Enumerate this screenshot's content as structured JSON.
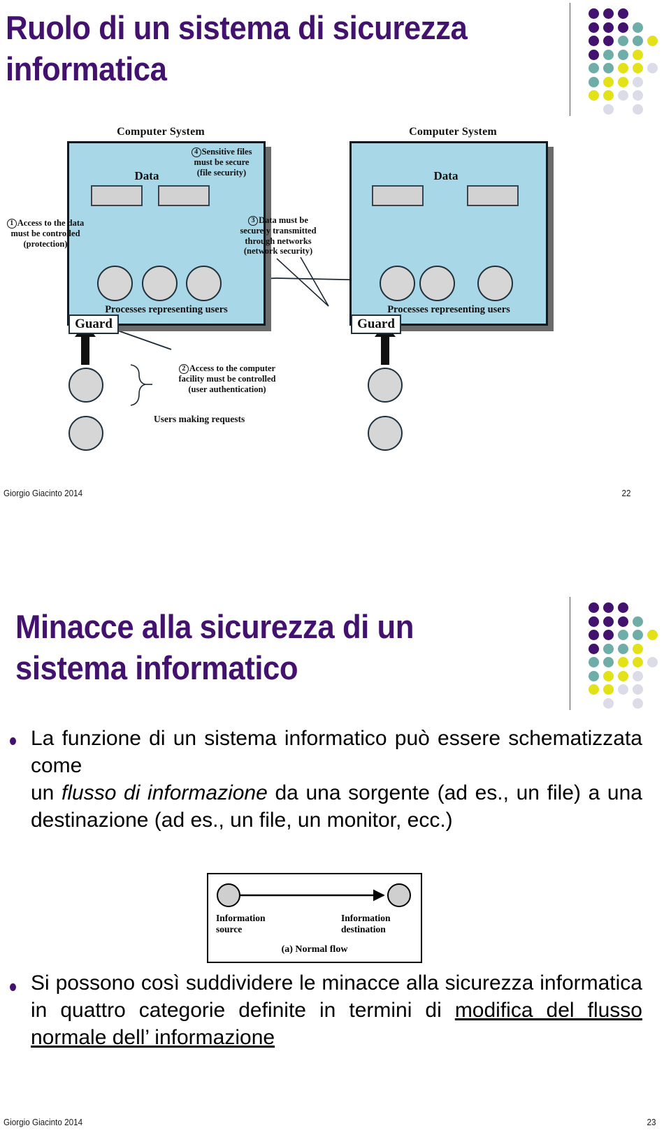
{
  "brand": {
    "purple": "#42126e",
    "teal": "#6fada8",
    "yellow": "#e3e118",
    "lavender": "#dcdce8",
    "diagram_fill": "#a8d7e8",
    "shape_fill": "#d3d3d3"
  },
  "logo": {
    "name": "dot-matrix-logo",
    "rows": [
      [
        "purple",
        "purple",
        "purple",
        "none",
        "none"
      ],
      [
        "purple",
        "purple",
        "purple",
        "teal",
        "none"
      ],
      [
        "purple",
        "purple",
        "teal",
        "teal",
        "yellow"
      ],
      [
        "purple",
        "teal",
        "teal",
        "yellow",
        "none"
      ],
      [
        "teal",
        "teal",
        "yellow",
        "yellow",
        "lavender"
      ],
      [
        "teal",
        "yellow",
        "yellow",
        "lavender",
        "none"
      ],
      [
        "yellow",
        "yellow",
        "lavender",
        "lavender",
        "none"
      ],
      [
        "none",
        "lavender",
        "none",
        "lavender",
        "none"
      ]
    ]
  },
  "slide1": {
    "title": "Ruolo di un sistema di sicurezza informatica",
    "footer_author": "Giorgio Giacinto 2014",
    "footer_page": "22",
    "figure": {
      "name": "computer-security-roles-diagram",
      "systems": [
        {
          "title": "Computer System",
          "data_label": "Data",
          "processes_label": "Processes representing users",
          "guard_label": "Guard"
        },
        {
          "title": "Computer System",
          "data_label": "Data",
          "processes_label": "Processes representing users",
          "guard_label": "Guard"
        }
      ],
      "annotations": [
        {
          "number": "1",
          "lines": [
            "Access to the data",
            "must be controlled",
            "(protection)"
          ]
        },
        {
          "number": "2",
          "lines": [
            "Access to the computer",
            "facility must be controlled",
            "(user authentication)"
          ]
        },
        {
          "number": "3",
          "lines": [
            "Data must be",
            "securely transmitted",
            "through networks",
            "(network security)"
          ]
        },
        {
          "number": "4",
          "lines": [
            "Sensitive files",
            "must be secure",
            "(file security)"
          ]
        }
      ],
      "users_label": "Users making requests"
    }
  },
  "slide2": {
    "title": "Minacce alla sicurezza di un sistema informatico",
    "footer_author": "Giorgio Giacinto 2014",
    "footer_page": "23",
    "bullet1": {
      "line1": "La funzione di un sistema informatico può essere schematizzata come",
      "line2_a": "un ",
      "line2_italic": "flusso di informazione",
      "line2_b": " da una sorgente (ad es., un file) a una destinazione (ad es., un file, un monitor, ecc.)"
    },
    "bullet2": {
      "part_a": "Si possono così suddividere le minacce alla sicurezza informatica in quattro categorie definite in termini di ",
      "part_underlined": "modifica del flusso normale dell’ informazione"
    },
    "flow_figure": {
      "name": "normal-flow-diagram",
      "source_label_l1": "Information",
      "source_label_l2": "source",
      "destination_label_l1": "Information",
      "destination_label_l2": "destination",
      "caption": "(a) Normal flow"
    }
  }
}
